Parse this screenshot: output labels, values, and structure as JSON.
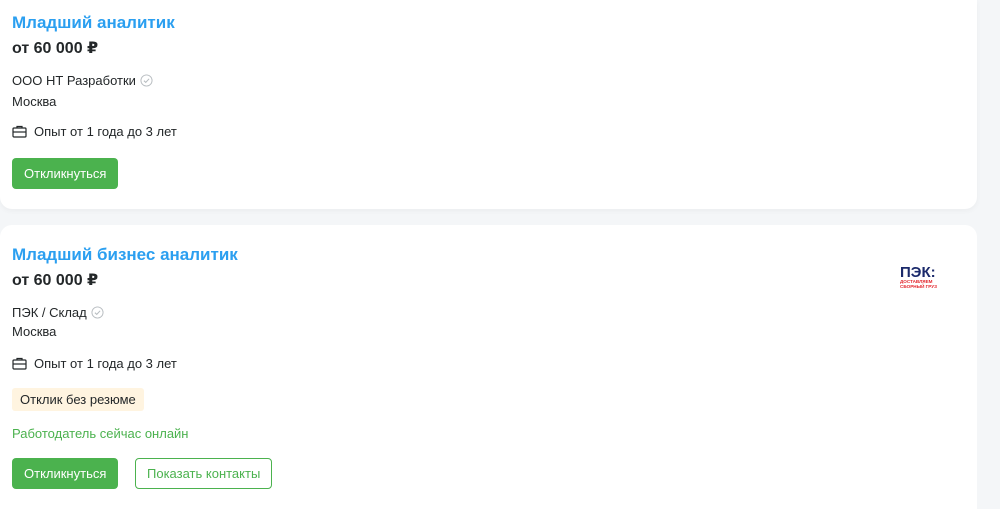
{
  "vacancies": [
    {
      "title": "Младший аналитик",
      "salary": "от 60 000 ₽",
      "company": "ООО НТ Разработки",
      "city": "Москва",
      "experience": "Опыт от 1 года до 3 лет",
      "respond_label": "Откликнуться"
    },
    {
      "title": "Младший бизнес аналитик",
      "salary": "от 60 000 ₽",
      "company": "ПЭК / Склад",
      "city": "Москва",
      "experience": "Опыт от 1 года до 3 лет",
      "badge": "Отклик без резюме",
      "online_status": "Работодатель сейчас онлайн",
      "respond_label": "Откликнуться",
      "contacts_label": "Показать контакты",
      "logo": {
        "text": "ПЭК:",
        "tagline_1": "ДОСТАВЛЯЕМ",
        "tagline_2": "СБОРНЫЙ ГРУЗ",
        "color": "#e3262d",
        "text_color": "#1b2a6b"
      }
    }
  ],
  "colors": {
    "title": "#2b9ff0",
    "accent_green": "#4bb24e",
    "badge_bg": "#fff4e0"
  },
  "icons": {
    "verified": "check-circle-icon",
    "experience": "briefcase-icon"
  }
}
